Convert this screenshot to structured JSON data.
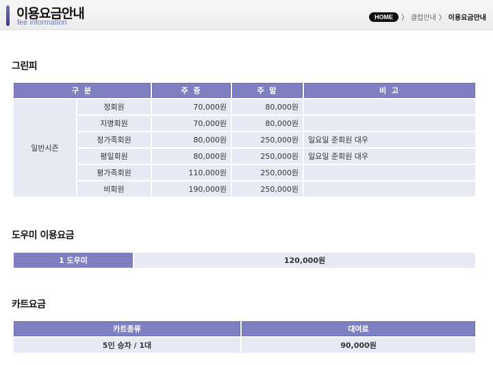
{
  "header": {
    "title": "이용요금안내",
    "subtitle": "fee information",
    "breadcrumb": {
      "home": "HOME",
      "items": [
        "클럽안내",
        "이용요금안내"
      ]
    }
  },
  "green_fee": {
    "section_title": "그린피",
    "columns": [
      "구 분",
      "주 중",
      "주 말",
      "비 고"
    ],
    "season_label": "일반시즌",
    "rows": [
      {
        "type": "정회원",
        "weekday": "70,000원",
        "weekend": "80,000원",
        "note": ""
      },
      {
        "type": "지명회원",
        "weekday": "70,000원",
        "weekend": "80,000원",
        "note": ""
      },
      {
        "type": "정가족회원",
        "weekday": "80,000원",
        "weekend": "250,000원",
        "note": "일요일 준회원 대우"
      },
      {
        "type": "평일회원",
        "weekday": "80,000원",
        "weekend": "250,000원",
        "note": "일요일 준회원 대우"
      },
      {
        "type": "평가족회원",
        "weekday": "110,000원",
        "weekend": "250,000원",
        "note": ""
      },
      {
        "type": "비회원",
        "weekday": "190,000원",
        "weekend": "250,000원",
        "note": ""
      }
    ]
  },
  "caddie": {
    "section_title": "도우미 이용요금",
    "label": "1 도우미",
    "fee": "120,000원"
  },
  "cart": {
    "section_title": "카트요금",
    "columns": [
      "카트종류",
      "대여료"
    ],
    "rows": [
      {
        "kind": "5인 승차 / 1대",
        "fee": "90,000원"
      }
    ]
  },
  "colors": {
    "header_bg": "#7f80c1",
    "cell_bg": "#e9e9f5",
    "accent": "#3b3b86"
  }
}
